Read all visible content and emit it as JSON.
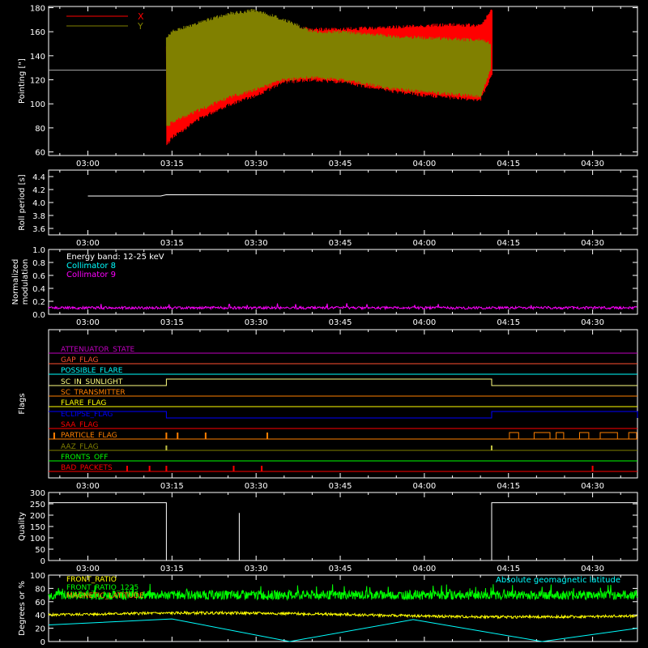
{
  "colors": {
    "background": "#000000",
    "axis": "#ffffff",
    "red": "#ff0000",
    "olive": "#808000",
    "white": "#ffffff",
    "cyan": "#00ffff",
    "magenta": "#ff00ff",
    "green": "#00ff00",
    "yellow": "#ffff00",
    "blue": "#0000ff",
    "orange": "#ff8000",
    "coral": "#ff5030",
    "purple": "#c000c0"
  },
  "time_ticks": [
    "03:00",
    "03:15",
    "03:30",
    "03:45",
    "04:00",
    "04:15",
    "04:30"
  ],
  "chart_data": [
    {
      "type": "line",
      "ylabel": "Pointing [\"]",
      "ylim": [
        57,
        181
      ],
      "yticks": [
        60,
        80,
        100,
        120,
        140,
        160,
        180
      ],
      "xlim": [
        "02:53",
        "04:38"
      ],
      "reference_line": 128,
      "series": [
        {
          "name": "X",
          "color": "#ff0000",
          "x": [
            "03:14",
            "03:15",
            "03:20",
            "03:25",
            "03:30",
            "03:35",
            "03:40",
            "03:45",
            "03:50",
            "03:55",
            "04:00",
            "04:05",
            "04:10",
            "04:12"
          ],
          "upper": [
            147,
            155,
            162,
            168,
            172,
            166,
            162,
            162,
            163,
            164,
            165,
            166,
            165,
            178
          ],
          "lower": [
            65,
            72,
            88,
            99,
            107,
            118,
            120,
            118,
            114,
            110,
            107,
            105,
            103,
            124
          ]
        },
        {
          "name": "Y",
          "color": "#808000",
          "x": [
            "03:14",
            "03:15",
            "03:20",
            "03:25",
            "03:30",
            "03:35",
            "03:40",
            "03:45",
            "03:50",
            "03:55",
            "04:00",
            "04:05",
            "04:10",
            "04:12"
          ],
          "upper": [
            155,
            160,
            168,
            175,
            178,
            170,
            160,
            160,
            158,
            156,
            155,
            154,
            153,
            150
          ],
          "lower": [
            80,
            85,
            95,
            105,
            112,
            120,
            122,
            120,
            116,
            112,
            110,
            108,
            106,
            130
          ]
        }
      ]
    },
    {
      "type": "line",
      "ylabel": "Roll period [s]",
      "ylim": [
        3.5,
        4.5
      ],
      "yticks": [
        "3.6",
        "3.8",
        "4.0",
        "4.2",
        "4.4"
      ],
      "series": [
        {
          "color": "#ffffff",
          "x": [
            "03:00",
            "03:13",
            "03:14",
            "04:38"
          ],
          "values": [
            4.1,
            4.1,
            4.12,
            4.1
          ]
        }
      ]
    },
    {
      "type": "line",
      "ylabel_lines": [
        "Normalized",
        "modulation"
      ],
      "ylim": [
        0,
        1
      ],
      "yticks": [
        "0.0",
        "0.2",
        "0.4",
        "0.6",
        "0.8",
        "1.0"
      ],
      "annotations": [
        {
          "text": "Energy band: 12-25 keV",
          "color": "#ffffff"
        },
        {
          "text": "Collimator 8",
          "color": "#00ffff"
        },
        {
          "text": "Collimator 9",
          "color": "#ff00ff"
        }
      ],
      "series": [
        {
          "name": "Collimator 9",
          "color": "#ff00ff",
          "mean": 0.1,
          "noise": 0.02
        }
      ]
    },
    {
      "type": "line",
      "ylabel": "Flags",
      "flags": [
        {
          "name": "ATTENUATOR_STATE",
          "color": "#c000c0",
          "segments": []
        },
        {
          "name": "GAP_FLAG",
          "color": "#ff5030",
          "segments": []
        },
        {
          "name": "POSSIBLE_FLARE",
          "color": "#00ffff",
          "segments": []
        },
        {
          "name": "SC_IN_SUNLIGHT",
          "color": "#ffff80",
          "segments": [
            [
              "03:14",
              "04:12"
            ]
          ]
        },
        {
          "name": "SC_TRANSMITTER",
          "color": "#ff8000",
          "segments": []
        },
        {
          "name": "FLARE_FLAG",
          "color": "#ffff00",
          "segments": []
        },
        {
          "name": "ECLIPSE_FLAG",
          "color": "#0000ff",
          "segments": [
            [
              "02:53",
              "03:14"
            ],
            [
              "04:12",
              "04:38"
            ]
          ]
        },
        {
          "name": "SAA_FLAG",
          "color": "#ff0000",
          "segments": []
        },
        {
          "name": "PARTICLE_FLAG",
          "color": "#ff8000",
          "segments": []
        },
        {
          "name": "AAZ_FLAG",
          "color": "#808000",
          "segments": []
        },
        {
          "name": "FRONTS_OFF",
          "color": "#00ff00",
          "segments": []
        },
        {
          "name": "BAD_PACKETS",
          "color": "#ff0000",
          "segments": []
        }
      ],
      "particle_spikes": [
        "02:54",
        "03:14",
        "03:16",
        "03:21",
        "03:32"
      ],
      "aaz_spikes": [
        "03:14",
        "04:12"
      ],
      "bad_packet_spikes": [
        "03:07",
        "03:11",
        "03:14",
        "03:26",
        "03:31",
        "04:30"
      ]
    },
    {
      "type": "line",
      "ylabel": "Quality",
      "ylim": [
        0,
        300
      ],
      "yticks": [
        "0",
        "50",
        "100",
        "150",
        "200",
        "250",
        "300"
      ],
      "series": [
        {
          "color": "#ffffff",
          "x": [
            "02:53",
            "03:14",
            "03:14",
            "03:27",
            "03:27",
            "03:27",
            "04:12",
            "04:12",
            "04:38"
          ],
          "values": [
            255,
            255,
            0,
            0,
            210,
            0,
            0,
            255,
            255
          ]
        }
      ]
    },
    {
      "type": "line",
      "ylabel": "Degrees or %",
      "ylim": [
        0,
        100
      ],
      "yticks": [
        "0",
        "20",
        "40",
        "60",
        "80",
        "100"
      ],
      "legend": [
        {
          "text": "FRONT_RATIO",
          "color": "#ffff00"
        },
        {
          "text": "FRONT_RATIO_1225",
          "color": "#00ff00"
        },
        {
          "text": "MAGNETIC_LATITUDE",
          "color": "#ff8000"
        }
      ],
      "annotation": {
        "text": "Absolute geomagnetic latitude",
        "color": "#00ffff"
      },
      "series": [
        {
          "name": "FRONT_RATIO_1225",
          "color": "#00ff00",
          "mean": 70,
          "noise": 7
        },
        {
          "name": "FRONT_RATIO",
          "color": "#ffff00",
          "mean": 40,
          "noise": 2
        },
        {
          "name": "Absolute geomagnetic latitude",
          "color": "#00ffff",
          "x": [
            "02:53",
            "03:15",
            "03:36",
            "03:58",
            "04:21",
            "04:38"
          ],
          "values": [
            25,
            34,
            0,
            33,
            0,
            20
          ]
        }
      ]
    }
  ]
}
